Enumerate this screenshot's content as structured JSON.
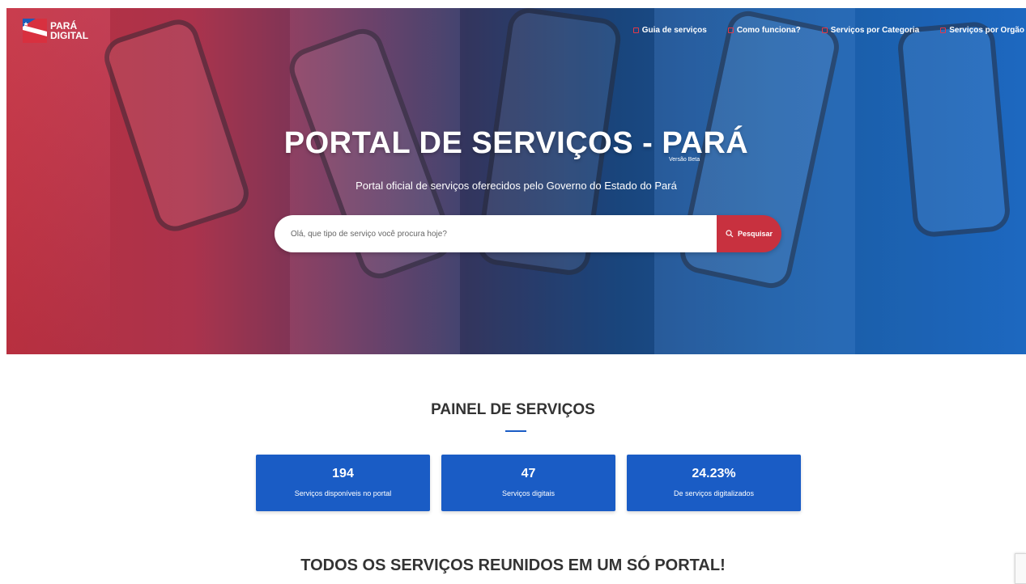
{
  "logo": {
    "line1": "PARÁ",
    "line2": "DIGITAL"
  },
  "nav": [
    {
      "label": "Guia de serviços"
    },
    {
      "label": "Como funciona?"
    },
    {
      "label": "Serviços por Categoria"
    },
    {
      "label": "Serviços por Orgão"
    }
  ],
  "hero": {
    "title": "PORTAL DE SERVIÇOS - PARÁ",
    "beta": "Versão Beta",
    "subtitle": "Portal oficial de serviços oferecidos pelo Governo do Estado do Pará"
  },
  "search": {
    "placeholder": "Olá, que tipo de serviço você procura hoje?",
    "button_label": "Pesquisar"
  },
  "painel": {
    "title": "PAINEL DE SERVIÇOS",
    "cards": [
      {
        "value": "194",
        "label": "Serviços disponíveis no portal"
      },
      {
        "value": "47",
        "label": "Serviços digitais"
      },
      {
        "value": "24.23%",
        "label": "De serviços digitalizados"
      }
    ]
  },
  "bottom": {
    "title": "TODOS OS SERVIÇOS REUNIDOS EM UM SÓ PORTAL!"
  },
  "colors": {
    "accent_red": "#c8313f",
    "primary_blue": "#1a5cc5"
  }
}
